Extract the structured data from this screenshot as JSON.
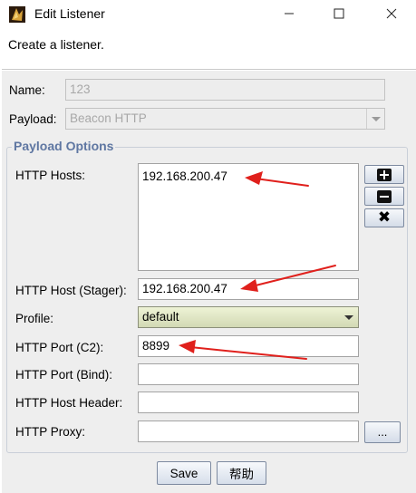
{
  "window": {
    "title": "Edit Listener",
    "minimize_icon": "minimize-icon",
    "maximize_icon": "maximize-icon",
    "close_icon": "close-icon"
  },
  "description": "Create a listener.",
  "form": {
    "name_label": "Name:",
    "name_value": "123",
    "payload_label": "Payload:",
    "payload_value": "Beacon HTTP"
  },
  "payload_options": {
    "title": "Payload Options",
    "http_hosts_label": "HTTP Hosts:",
    "http_hosts_value": "192.168.200.47",
    "add_icon": "plus-icon",
    "remove_icon": "minus-icon",
    "clear_icon": "x-icon",
    "host_stager_label": "HTTP Host (Stager):",
    "host_stager_value": "192.168.200.47",
    "profile_label": "Profile:",
    "profile_value": "default",
    "port_c2_label": "HTTP Port (C2):",
    "port_c2_value": "8899",
    "port_bind_label": "HTTP Port (Bind):",
    "port_bind_value": "",
    "host_header_label": "HTTP Host Header:",
    "host_header_value": "",
    "proxy_label": "HTTP Proxy:",
    "proxy_value": "",
    "proxy_button_label": "..."
  },
  "buttons": {
    "save_label": "Save",
    "help_label": "帮助"
  },
  "colors": {
    "group_title": "#5f77a2",
    "annotation_arrow": "#e0201c",
    "profile_combo": "#dfe5c2"
  }
}
